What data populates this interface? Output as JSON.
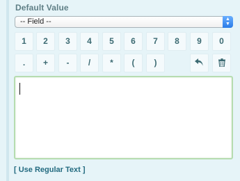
{
  "header": {
    "title": "Default Value"
  },
  "field_select": {
    "selected": "-- Field --"
  },
  "keypad": {
    "digits": [
      "1",
      "2",
      "3",
      "4",
      "5",
      "6",
      "7",
      "8",
      "9",
      "0"
    ],
    "operators": [
      ".",
      "+",
      "-",
      "/",
      "*",
      "(",
      ")"
    ],
    "undo_icon": "undo-icon",
    "delete_icon": "trash-icon"
  },
  "editor": {
    "value": ""
  },
  "footer": {
    "link": "[ Use Regular Text ]"
  },
  "colors": {
    "panel_bg": "#e6f4f8",
    "key_bg": "#f4fafc",
    "key_text": "#3d6b73",
    "editor_border": "#b6dcb0",
    "link": "#246b80",
    "select_arrow": "#2a7ce8"
  }
}
